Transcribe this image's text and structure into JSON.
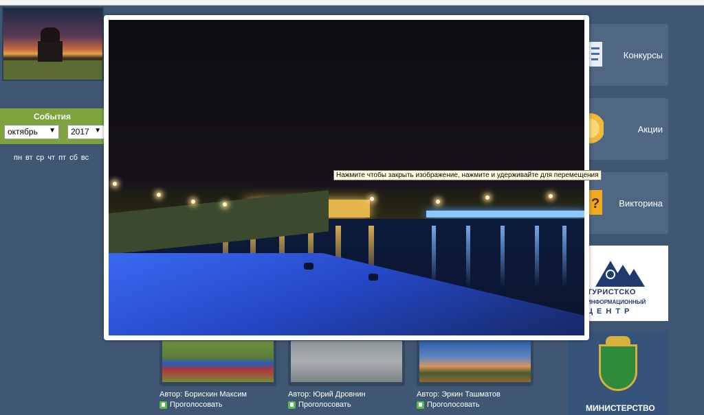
{
  "events": {
    "title": "События",
    "month": "октябрь",
    "year": "2017",
    "weekdays": [
      "пн",
      "вт",
      "ср",
      "чт",
      "пт",
      "сб",
      "вс"
    ]
  },
  "menu": {
    "contests": "Конкурсы",
    "promos": "Акции",
    "quiz": "Викторина"
  },
  "tic": {
    "line1": "ТУРИСТСКО",
    "line2": "ИНФОРМАЦИОННЫЙ",
    "line3": "ЦЕНТР"
  },
  "ministry": {
    "label": "МИНИСТЕРСТВО"
  },
  "gallery": [
    {
      "author": "Автор: Борискин Максим",
      "vote": "Проголосовать"
    },
    {
      "author": "Автор: Юрий Дровнин",
      "vote": "Проголосовать"
    },
    {
      "author": "Автор: Эркин Ташматов",
      "vote": "Проголосовать"
    }
  ],
  "lightbox": {
    "tooltip": "Нажмите чтобы закрыть изображение, нажмите и удерживайте для перемещения"
  }
}
